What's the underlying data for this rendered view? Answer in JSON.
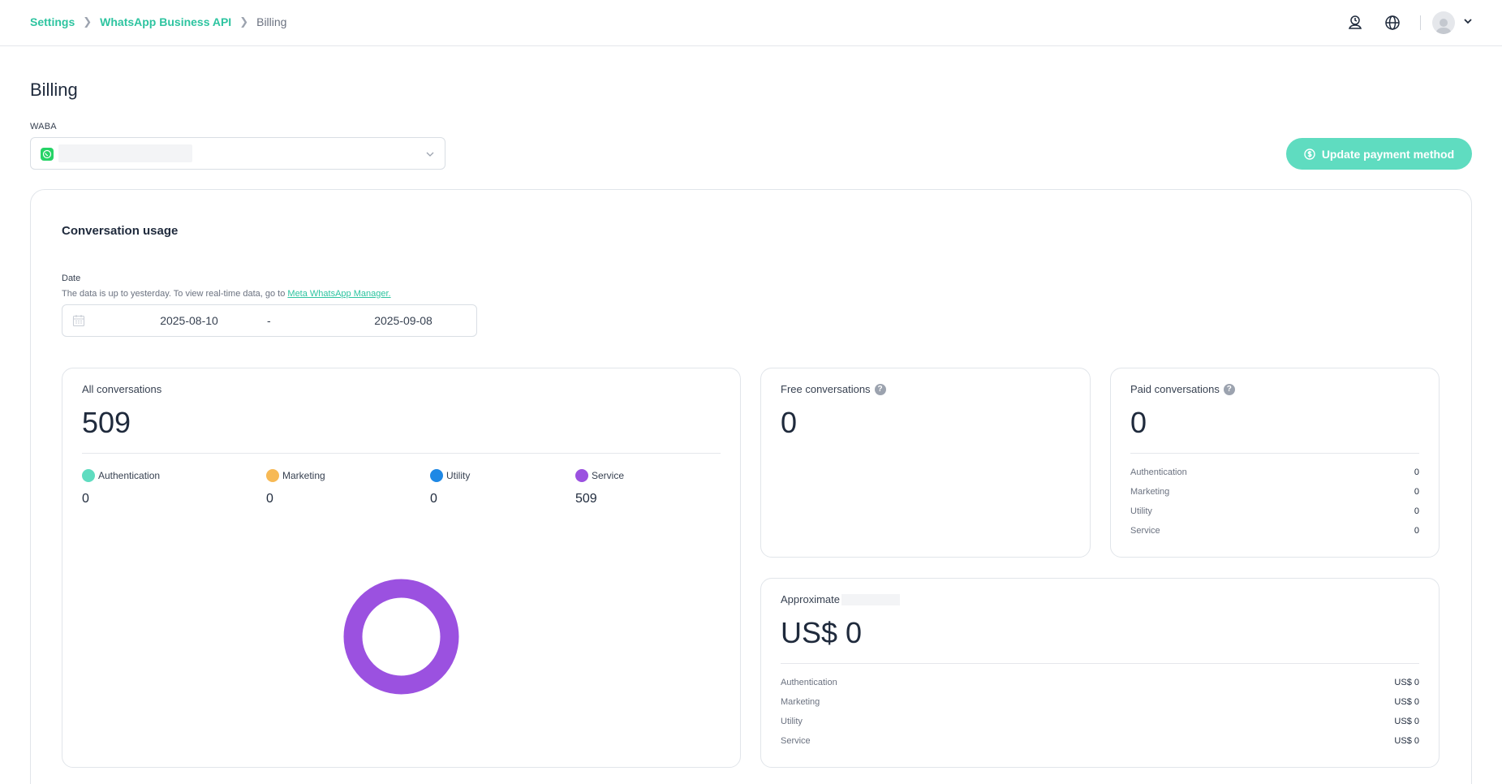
{
  "breadcrumb": {
    "items": [
      "Settings",
      "WhatsApp Business API"
    ],
    "current": "Billing"
  },
  "page": {
    "title": "Billing",
    "waba_label": "WABA",
    "update_payment_label": "Update payment method"
  },
  "usage": {
    "title": "Conversation usage",
    "date_label": "Date",
    "date_note": "The data is up to yesterday. To view real-time data, go to ",
    "date_note_link": "Meta WhatsApp Manager.",
    "start_date": "2025-08-10",
    "end_date": "2025-09-08",
    "range_separator": "-"
  },
  "all_conversations": {
    "title": "All conversations",
    "total": "509",
    "categories": [
      {
        "label": "Authentication",
        "value": "0",
        "color": "#5fdcc0"
      },
      {
        "label": "Marketing",
        "value": "0",
        "color": "#f7b955"
      },
      {
        "label": "Utility",
        "value": "0",
        "color": "#1e88e5"
      },
      {
        "label": "Service",
        "value": "509",
        "color": "#9b51e0"
      }
    ]
  },
  "free_conversations": {
    "title": "Free conversations",
    "total": "0"
  },
  "paid_conversations": {
    "title": "Paid conversations",
    "total": "0",
    "rows": [
      {
        "label": "Authentication",
        "value": "0"
      },
      {
        "label": "Marketing",
        "value": "0"
      },
      {
        "label": "Utility",
        "value": "0"
      },
      {
        "label": "Service",
        "value": "0"
      }
    ]
  },
  "approximate": {
    "title": "Approximate",
    "total": "US$ 0",
    "rows": [
      {
        "label": "Authentication",
        "value": "US$ 0"
      },
      {
        "label": "Marketing",
        "value": "US$ 0"
      },
      {
        "label": "Utility",
        "value": "US$ 0"
      },
      {
        "label": "Service",
        "value": "US$ 0"
      }
    ]
  },
  "colors": {
    "accent": "#2ec4a0",
    "button": "#5fdcc0",
    "donut": "#9b51e0"
  },
  "icons": [
    "support-agent-icon",
    "globe-icon",
    "avatar-icon",
    "chevron-down-icon",
    "whatsapp-icon",
    "calendar-icon",
    "help-icon",
    "payment-icon"
  ]
}
